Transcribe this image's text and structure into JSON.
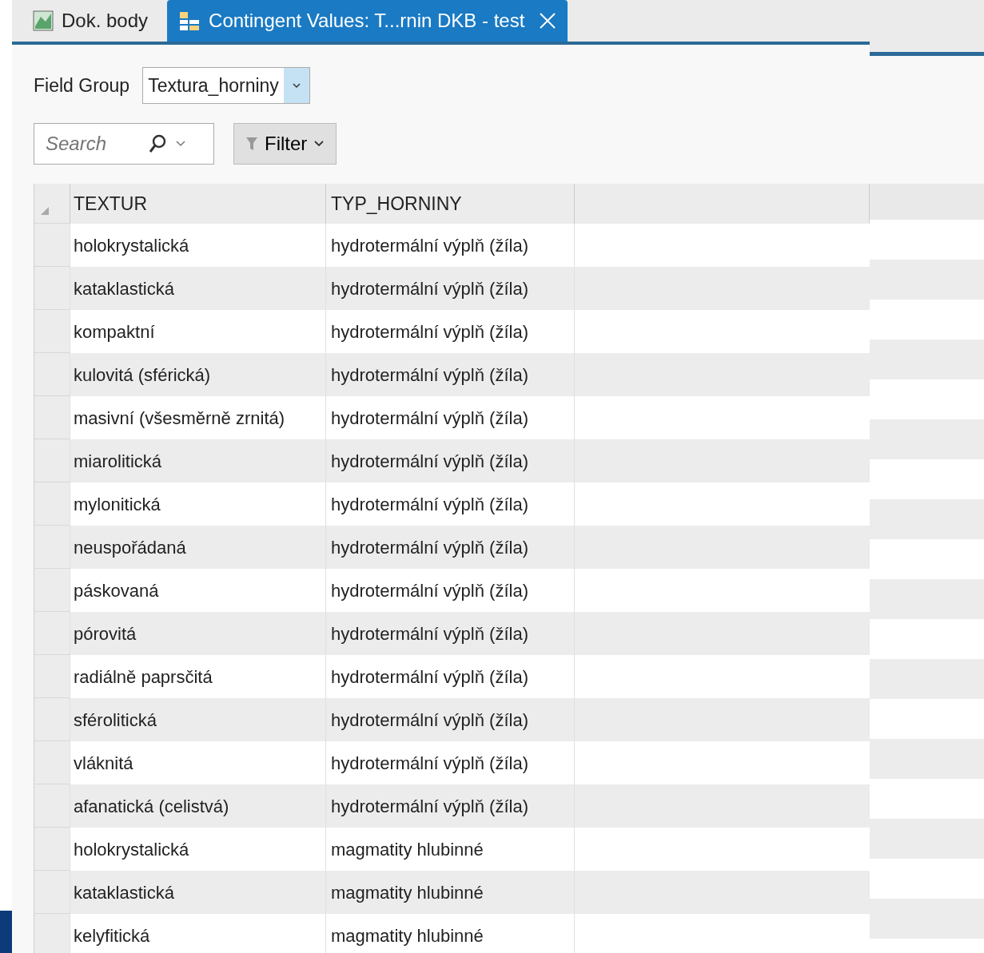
{
  "tabs": [
    {
      "label": "Dok. body",
      "selected": false,
      "kind": "map"
    },
    {
      "label": "Contingent Values: T...rnin DKB - test",
      "selected": true,
      "kind": "table"
    }
  ],
  "field_group": {
    "label": "Field Group",
    "value": "Textura_horniny"
  },
  "search": {
    "placeholder": "Search"
  },
  "filter_button": {
    "label": "Filter"
  },
  "table": {
    "columns": [
      "TEXTUR",
      "TYP_HORNINY"
    ],
    "rows": [
      [
        "holokrystalická",
        "hydrotermální výplň (žíla)"
      ],
      [
        "kataklastická",
        "hydrotermální výplň (žíla)"
      ],
      [
        "kompaktní",
        "hydrotermální výplň (žíla)"
      ],
      [
        "kulovitá (sférická)",
        "hydrotermální výplň (žíla)"
      ],
      [
        "masivní (všesměrně zrnitá)",
        "hydrotermální výplň (žíla)"
      ],
      [
        "miarolitická",
        "hydrotermální výplň (žíla)"
      ],
      [
        "mylonitická",
        "hydrotermální výplň (žíla)"
      ],
      [
        "neuspořádaná",
        "hydrotermální výplň (žíla)"
      ],
      [
        "páskovaná",
        "hydrotermální výplň (žíla)"
      ],
      [
        "pórovitá",
        "hydrotermální výplň (žíla)"
      ],
      [
        "radiálně paprsčitá",
        "hydrotermální výplň (žíla)"
      ],
      [
        "sférolitická",
        "hydrotermální výplň (žíla)"
      ],
      [
        "vláknitá",
        "hydrotermální výplň (žíla)"
      ],
      [
        "afanatická (celistvá)",
        "hydrotermální výplň (žíla)"
      ],
      [
        "holokrystalická",
        "magmatity hlubinné"
      ],
      [
        "kataklastická",
        "magmatity hlubinné"
      ],
      [
        "kelyfitická",
        "magmatity hlubinné"
      ]
    ]
  }
}
